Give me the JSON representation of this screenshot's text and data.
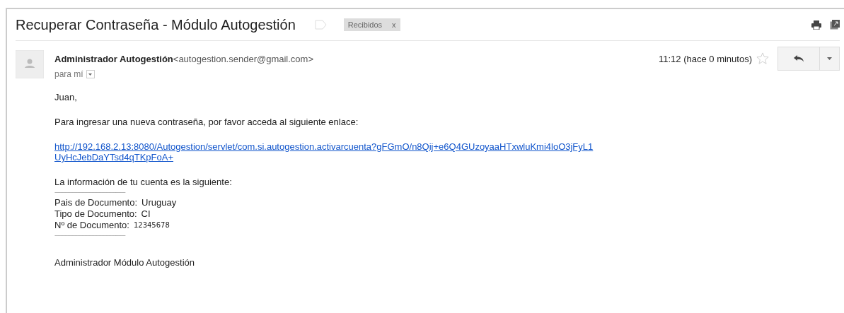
{
  "subject": "Recuperar Contraseña - Módulo Autogestión",
  "labels": [
    {
      "text": "Recibidos",
      "close": "x"
    }
  ],
  "sender": {
    "name": "Administrador Autogestión",
    "email": "<autogestion.sender@gmail.com>",
    "recipient": "para mí",
    "time": "11:12 (hace 0 minutos)",
    "starred": false
  },
  "body": {
    "greeting": "Juan,",
    "intro": "Para ingresar una nueva contraseña, por favor acceda al siguiente enlace:",
    "link": [
      "http://192.168.2.13:8080/Autogestion/servlet/com.si.autogestion.activarcuenta?gFGmO/n8Qij+e6Q4GUzoyaaHTxwluKmi4loO3jFyL1",
      "UyHcJebDaYTsd4qTKpFoA+"
    ],
    "info_heading": "La información de tu cuenta es la siguiente:",
    "separator": "--------------------------------------------------",
    "fields": [
      {
        "label": "Pais de Documento:",
        "value": "Uruguay"
      },
      {
        "label": "Tipo de Documento:",
        "value": "CI"
      },
      {
        "label": "Nº de Documento:",
        "value": "12345678",
        "kind": "mono"
      }
    ],
    "separator_end": "--------------------------------------------------",
    "signature": "Administrador Módulo Autogestión"
  }
}
